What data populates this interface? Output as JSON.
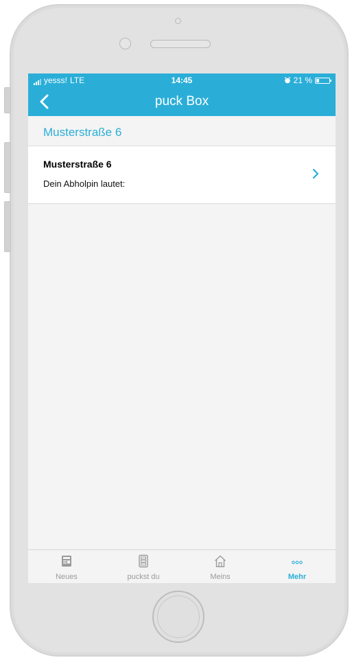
{
  "status_bar": {
    "carrier": "yesss!",
    "network": "LTE",
    "time": "14:45",
    "battery": "21 %",
    "battery_level": 0.21,
    "alarm_icon": "alarm-clock-icon"
  },
  "nav": {
    "title": "puck Box",
    "back_icon": "chevron-left-icon"
  },
  "section": {
    "title": "Musterstraße 6"
  },
  "list": {
    "items": [
      {
        "title": "Musterstraße 6",
        "subtitle": "Dein Abholpin lautet:",
        "icon": "chevron-right-icon"
      }
    ]
  },
  "tabs": [
    {
      "label": "Neues",
      "icon": "newspaper-icon",
      "active": false
    },
    {
      "label": "puckst du",
      "icon": "locker-icon",
      "active": false
    },
    {
      "label": "Meins",
      "icon": "home-icon",
      "active": false
    },
    {
      "label": "Mehr",
      "icon": "more-icon",
      "active": true
    }
  ],
  "colors": {
    "accent": "#2aaed8",
    "background": "#f4f4f4",
    "inactive_tab": "#9a9a9a"
  }
}
